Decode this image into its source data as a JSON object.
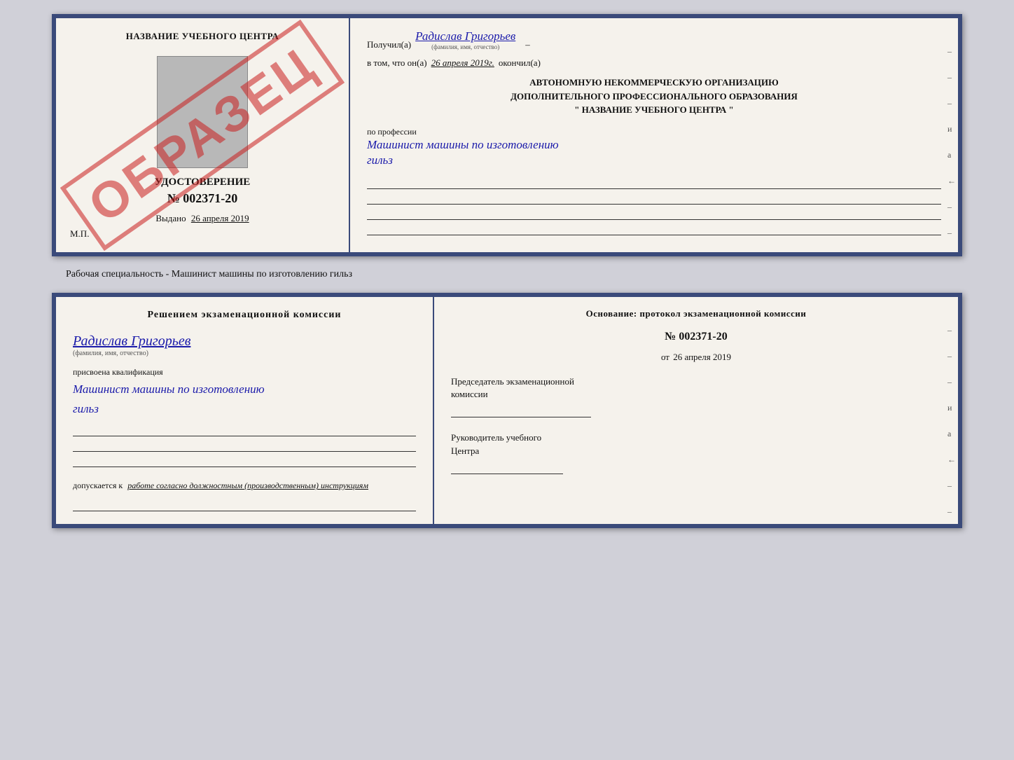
{
  "top_doc": {
    "left": {
      "title": "НАЗВАНИЕ УЧЕБНОГО ЦЕНТРА",
      "watermark": "ОБРАЗЕЦ",
      "udost_title": "УДОСТОВЕРЕНИЕ",
      "udost_number": "№ 002371-20",
      "vydano": "Выдано",
      "vydano_date": "26 апреля 2019",
      "mp": "М.П."
    },
    "right": {
      "poluchil": "Получил(а)",
      "name": "Радислав Григорьев",
      "name_label": "(фамилия, имя, отчество)",
      "vtom_prefix": "в том, что он(а)",
      "date": "26 апреля 2019г.",
      "okonchil": "окончил(а)",
      "org_line1": "АВТОНОМНУЮ НЕКОММЕРЧЕСКУЮ ОРГАНИЗАЦИЮ",
      "org_line2": "ДОПОЛНИТЕЛЬНОГО ПРОФЕССИОНАЛЬНОГО ОБРАЗОВАНИЯ",
      "org_line3": "\"   НАЗВАНИЕ УЧЕБНОГО ЦЕНТРА   \"",
      "po_professii": "по профессии",
      "profession": "Машинист машины по изготовлению",
      "profession2": "гильз",
      "side_marks": [
        "-",
        "-",
        "-",
        "и",
        "а",
        "←",
        "-",
        "-"
      ]
    }
  },
  "between_label": "Рабочая специальность - Машинист машины по изготовлению гильз",
  "bottom_doc": {
    "left": {
      "resheniem": "Решением  экзаменационной  комиссии",
      "name": "Радислав Григорьев",
      "name_label": "(фамилия, имя, отчество)",
      "prisvoyena": "присвоена квалификация",
      "kvalif": "Машинист машины по изготовлению",
      "kvalif2": "гильз",
      "dopuskaetsya": "допускается к",
      "dopusk_text": "работе согласно должностным (производственным) инструкциям"
    },
    "right": {
      "osnov": "Основание: протокол экзаменационной  комиссии",
      "number": "№  002371-20",
      "ot": "от",
      "date": "26 апреля 2019",
      "predsed_title": "Председатель экзаменационной",
      "predsed_sub": "комиссии",
      "rukov_title": "Руководитель учебного",
      "rukov_sub": "Центра",
      "side_marks": [
        "-",
        "-",
        "-",
        "и",
        "а",
        "←",
        "-",
        "-"
      ]
    }
  }
}
